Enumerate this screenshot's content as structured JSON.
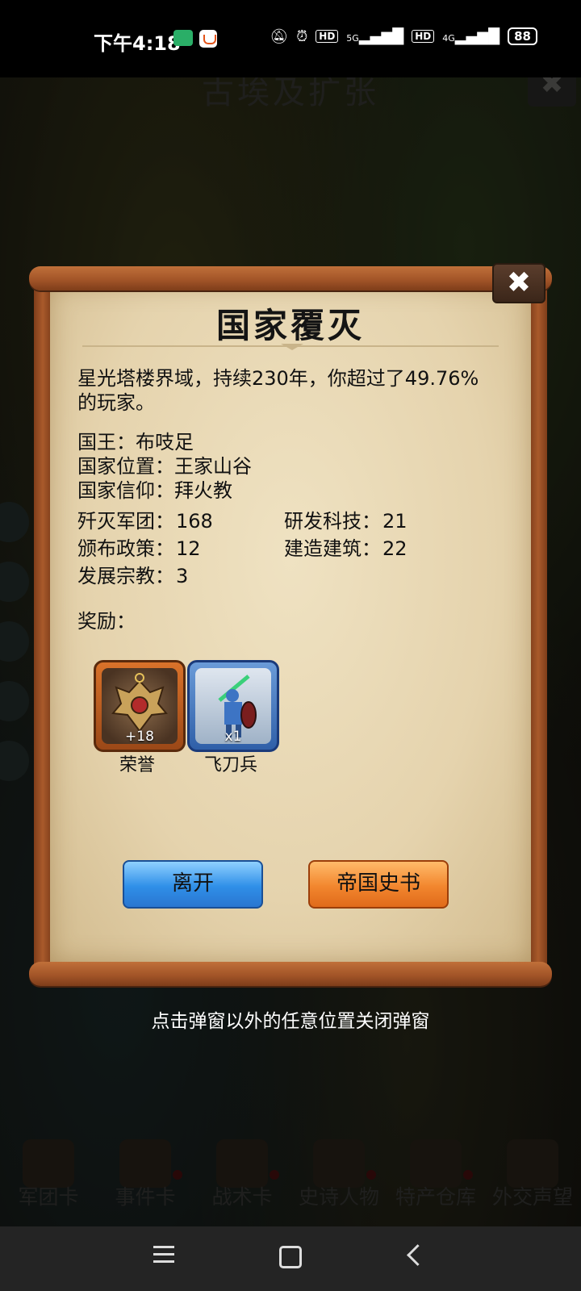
{
  "status_bar": {
    "time": "下午4:18",
    "icons": [
      "mute-icon",
      "alarm-icon",
      "HD",
      "5G",
      "signal-icon",
      "HD",
      "4G",
      "signal-icon"
    ],
    "hd_label": "HD",
    "net_5g": "5G",
    "net_4g": "4G",
    "battery": "88"
  },
  "game": {
    "title": "古埃及扩张",
    "close_symbol": "✖"
  },
  "dialog": {
    "title": "国家覆灭",
    "close_symbol": "✖",
    "summary": "星光塔楼界域，持续230年，你超过了49.76%的玩家。",
    "king": "国王：布吱足",
    "location": "国家位置：王家山谷",
    "faith": "国家信仰：拜火教",
    "stats": {
      "armies_label": "歼灭军团：",
      "armies_value": "168",
      "tech_label": "研发科技：",
      "tech_value": "21",
      "policies_label": "颁布政策：",
      "policies_value": "12",
      "buildings_label": "建造建筑：",
      "buildings_value": "22",
      "religion_label": "发展宗教：",
      "religion_value": "3"
    },
    "rewards_heading": "奖励：",
    "rewards": [
      {
        "qty": "+18",
        "label": "荣誉"
      },
      {
        "qty": "x1",
        "label": "飞刀兵"
      }
    ],
    "leave_button": "离开",
    "history_button": "帝国史书"
  },
  "hint": "点击弹窗以外的任意位置关闭弹窗",
  "bottom_tabs": [
    "军团卡",
    "事件卡",
    "战术卡",
    "史诗人物",
    "特产仓库",
    "外交声望"
  ],
  "colors": {
    "leave_button": "#2f8fe8",
    "history_button": "#f2862e",
    "parchment": "#e5d3ad",
    "scroll_wood": "#a35528"
  }
}
